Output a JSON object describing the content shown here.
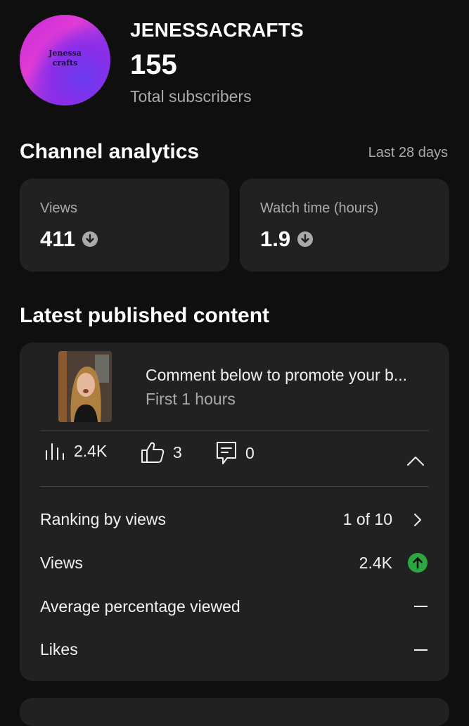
{
  "channel": {
    "avatar_text_line1": "Jenessa",
    "avatar_text_line2": "crafts",
    "name": "JENESSACRAFTS",
    "subscriber_count": "155",
    "subscriber_label": "Total subscribers"
  },
  "analytics": {
    "title": "Channel analytics",
    "range": "Last 28 days",
    "metrics": [
      {
        "label": "Views",
        "value": "411",
        "trend": "down",
        "icon": "arrow-down-circle-icon"
      },
      {
        "label": "Watch time (hours)",
        "value": "1.9",
        "trend": "down",
        "icon": "arrow-down-circle-icon"
      }
    ]
  },
  "latest": {
    "title": "Latest published content",
    "video": {
      "title": "Comment below to promote your b...",
      "subtitle": "First 1 hours"
    },
    "stats": [
      {
        "icon": "bar-chart-icon",
        "value": "2.4K"
      },
      {
        "icon": "thumbs-up-icon",
        "value": "3"
      },
      {
        "icon": "comment-icon",
        "value": "0"
      }
    ],
    "collapse_icon": "chevron-up-icon",
    "rows": [
      {
        "label": "Ranking by views",
        "value": "1 of 10",
        "icon": "chevron-right-icon"
      },
      {
        "label": "Views",
        "value": "2.4K",
        "icon": "arrow-up-circle-icon"
      },
      {
        "label": "Average percentage viewed",
        "value": "—"
      },
      {
        "label": "Likes",
        "value": "—"
      }
    ]
  },
  "colors": {
    "background": "#0f0f0f",
    "card": "#212121",
    "secondary_text": "#aaaaaa",
    "up_green": "#2ba640",
    "down_grey": "#aaaaaa"
  }
}
